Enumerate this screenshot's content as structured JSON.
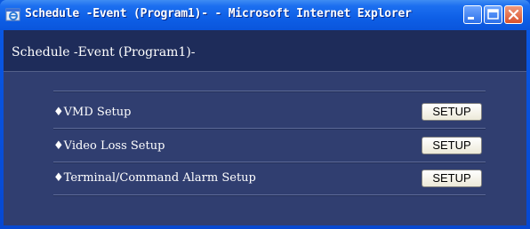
{
  "window": {
    "title": "Schedule -Event (Program1)- - Microsoft Internet Explorer"
  },
  "header": {
    "title": "Schedule -Event (Program1)-"
  },
  "rows": [
    {
      "label": "♦VMD Setup",
      "button": "SETUP"
    },
    {
      "label": "♦Video Loss Setup",
      "button": "SETUP"
    },
    {
      "label": "♦Terminal/Command Alarm Setup",
      "button": "SETUP"
    }
  ],
  "icons": {
    "app": "internet-explorer-icon",
    "minimize": "minimize-icon",
    "maximize": "maximize-icon",
    "close": "close-icon"
  },
  "colors": {
    "titlebar": "#0e5fe6",
    "client_bg": "#303e70",
    "header_bg": "#1e2c5a",
    "close_button": "#d9512c"
  }
}
